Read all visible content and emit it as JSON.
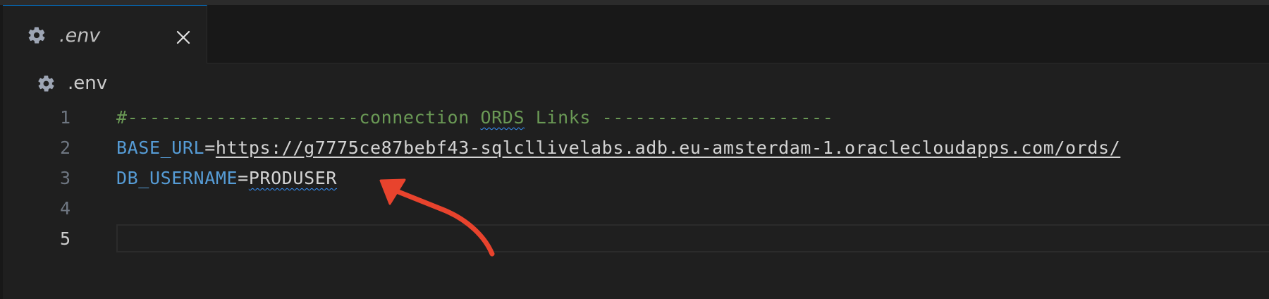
{
  "tab": {
    "label": ".env",
    "icon": "gear-icon",
    "close_icon": "close-icon"
  },
  "breadcrumb": {
    "label": ".env",
    "icon": "gear-icon"
  },
  "editor": {
    "active_line": 5,
    "lines": [
      {
        "number": "1",
        "comment_prefix": "#---------------------connection ",
        "comment_flagged": "ORDS",
        "comment_suffix": " Links ---------------------"
      },
      {
        "number": "2",
        "key": "BASE_URL",
        "equals": "=",
        "value": "https://g7775ce87bebf43-sqlcllivelabs.adb.eu-amsterdam-1.oraclecloudapps.com/ords/"
      },
      {
        "number": "3",
        "key": "DB_USERNAME",
        "equals": "=",
        "value": "PRODUSER"
      },
      {
        "number": "4"
      },
      {
        "number": "5"
      }
    ]
  },
  "colors": {
    "background": "#1f1f1f",
    "comment": "#6a9955",
    "key": "#569cd6",
    "text": "#d4d4d4",
    "annotation_arrow": "#e8432d",
    "tab_accent": "#0078d4"
  }
}
